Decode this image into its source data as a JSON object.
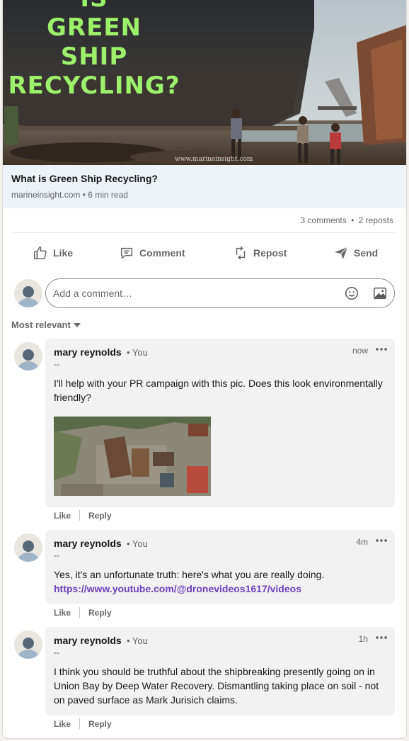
{
  "article": {
    "hero_text": "IS\nGREEN\nSHIP\nRECYCLING?",
    "hero_watermark": "www.marineinsight.com",
    "title": "What is Green Ship Recycling?",
    "source": "marineinsight.com • 6 min read"
  },
  "social": {
    "comments": "3 comments",
    "dot": "•",
    "reposts": "2 reposts"
  },
  "actions": {
    "like": "Like",
    "comment": "Comment",
    "repost": "Repost",
    "send": "Send"
  },
  "composer": {
    "placeholder": "Add a comment…",
    "emoji_icon": "emoji-icon",
    "image_icon": "image-icon"
  },
  "sort": {
    "label": "Most relevant"
  },
  "comments": [
    {
      "author": "mary reynolds",
      "you": "• You",
      "headline": "--",
      "time": "now",
      "text": "I'll help with your PR campaign with this pic. Does this look environmentally friendly?",
      "like": "Like",
      "reply": "Reply"
    },
    {
      "author": "mary reynolds",
      "you": "• You",
      "headline": "--",
      "time": "4m",
      "text": "Yes, it's an unfortunate truth: here's what you are really doing.",
      "link": "https://www.youtube.com/@dronevideos1617/videos",
      "like": "Like",
      "reply": "Reply"
    },
    {
      "author": "mary reynolds",
      "you": "• You",
      "headline": "--",
      "time": "1h",
      "text": "I think you should be truthful about the shipbreaking presently going on in Union Bay by Deep Water Recovery. Dismantling taking place on soil - not on paved surface as Mark Jurisich claims.",
      "like": "Like",
      "reply": "Reply"
    }
  ],
  "colors": {
    "link": "#6d3fc0",
    "hero_text": "#9cf06a",
    "article_meta_bg": "#edf3f8",
    "bubble_bg": "#f2f2f2"
  }
}
